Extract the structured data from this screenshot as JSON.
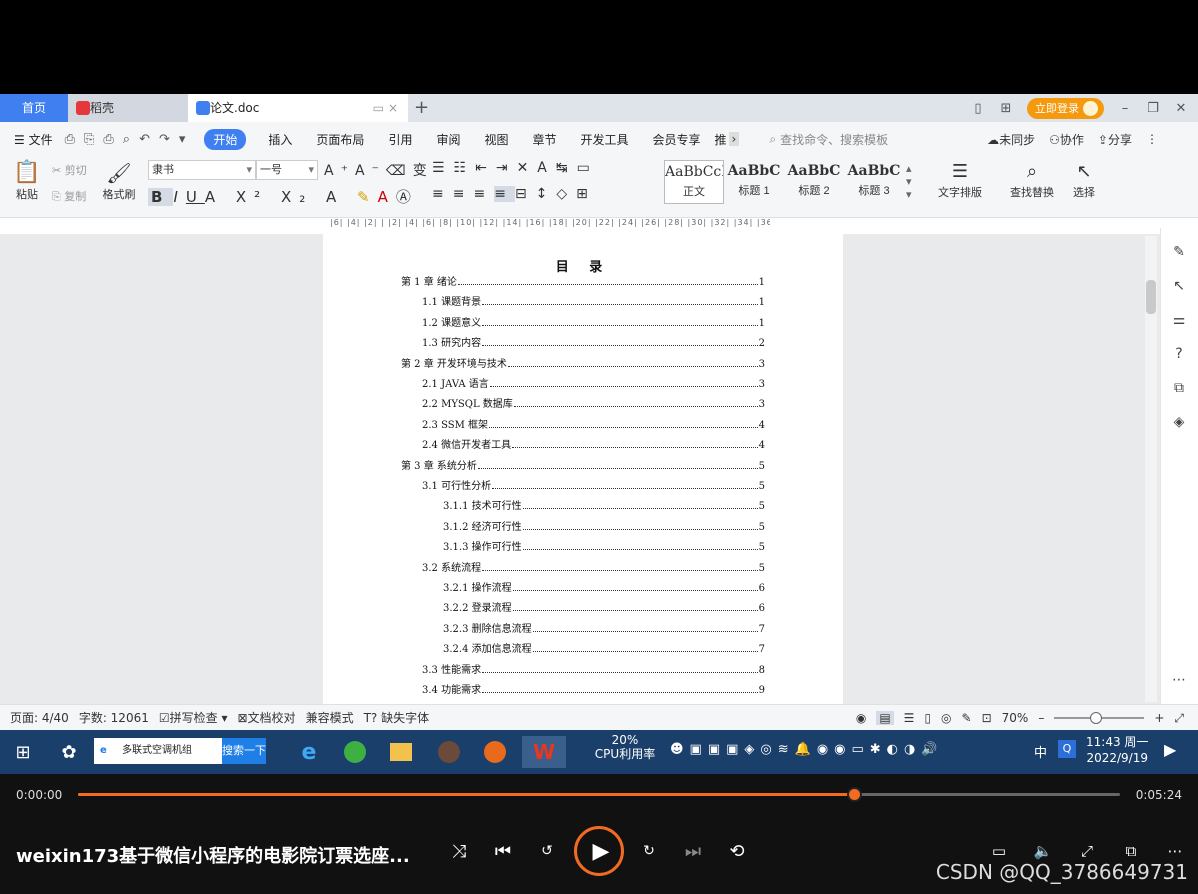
{
  "tabs": {
    "home": "首页",
    "daoke": "稻壳",
    "doc": "论文.doc"
  },
  "titlebar": {
    "login": "立即登录"
  },
  "menu": {
    "file": "文件",
    "items": [
      "开始",
      "插入",
      "页面布局",
      "引用",
      "审阅",
      "视图",
      "章节",
      "开发工具",
      "会员专享",
      "推"
    ],
    "search_placeholder": "查找命令、搜索模板",
    "unsynced": "未同步",
    "collab": "协作",
    "share": "分享"
  },
  "ribbon": {
    "paste": "粘贴",
    "cut": "剪切",
    "copy": "复制",
    "format_painter": "格式刷",
    "font_name": "隶书",
    "font_size": "一号",
    "styles": [
      {
        "preview": "AaBbCcI",
        "label": "正文"
      },
      {
        "preview": "AaBbC",
        "label": "标题 1"
      },
      {
        "preview": "AaBbC",
        "label": "标题 2"
      },
      {
        "preview": "AaBbC",
        "label": "标题 3"
      }
    ],
    "text_layout": "文字排版",
    "find_replace": "查找替换",
    "select": "选择"
  },
  "ruler_text": "|6| |4| |2| | |2| |4| |6| |8| |10| |12| |14| |16| |18| |20| |22| |24| |26| |28| |30| |32| |34| |36| |38| |40|",
  "document": {
    "toc_title": "目 录",
    "entries": [
      {
        "text": "第 1 章  绪论",
        "page": "1",
        "level": 1
      },
      {
        "text": "1.1  课题背景",
        "page": "1",
        "level": 2
      },
      {
        "text": "1.2  课题意义",
        "page": "1",
        "level": 2
      },
      {
        "text": "1.3  研究内容",
        "page": "2",
        "level": 2
      },
      {
        "text": "第 2 章  开发环境与技术",
        "page": "3",
        "level": 1
      },
      {
        "text": "2.1 JAVA 语言",
        "page": "3",
        "level": 2
      },
      {
        "text": "2.2 MYSQL 数据库",
        "page": "3",
        "level": 2
      },
      {
        "text": "2.3 SSM 框架",
        "page": "4",
        "level": 2
      },
      {
        "text": "2.4 微信开发者工具",
        "page": "4",
        "level": 2
      },
      {
        "text": "第 3 章  系统分析",
        "page": "5",
        "level": 1
      },
      {
        "text": "3.1  可行性分析",
        "page": "5",
        "level": 2
      },
      {
        "text": "3.1.1  技术可行性",
        "page": "5",
        "level": 3
      },
      {
        "text": "3.1.2  经济可行性",
        "page": "5",
        "level": 3
      },
      {
        "text": "3.1.3  操作可行性",
        "page": "5",
        "level": 3
      },
      {
        "text": "3.2  系统流程",
        "page": "5",
        "level": 2
      },
      {
        "text": "3.2.1  操作流程",
        "page": "6",
        "level": 3
      },
      {
        "text": "3.2.2  登录流程",
        "page": "6",
        "level": 3
      },
      {
        "text": "3.2.3  删除信息流程",
        "page": "7",
        "level": 3
      },
      {
        "text": "3.2.4  添加信息流程",
        "page": "7",
        "level": 3
      },
      {
        "text": "3.3  性能需求",
        "page": "8",
        "level": 2
      },
      {
        "text": "3.4  功能需求",
        "page": "9",
        "level": 2
      }
    ]
  },
  "statusbar": {
    "page": "页面: 4/40",
    "words": "字数: 12061",
    "spellcheck": "拼写检查",
    "proofread": "文档校对",
    "compat": "兼容模式",
    "missing_font": "缺失字体",
    "zoom": "70%"
  },
  "taskbar": {
    "search_text": "多联式空调机组",
    "search_button": "搜索一下",
    "cpu_percent": "20%",
    "cpu_label": "CPU利用率",
    "ime": "中",
    "time": "11:43 周一",
    "date": "2022/9/19"
  },
  "player": {
    "current_time": "0:00:00",
    "total_time": "0:05:24",
    "progress": 0.745,
    "title": "weixin173基于微信小程序的电影院订票选座...",
    "watermark": "CSDN @QQ_3786649731"
  },
  "colors": {
    "accent": "#3f7ff0",
    "player_accent": "#f36b21",
    "taskbar": "#1b3f6b",
    "login": "#f59a0e"
  }
}
